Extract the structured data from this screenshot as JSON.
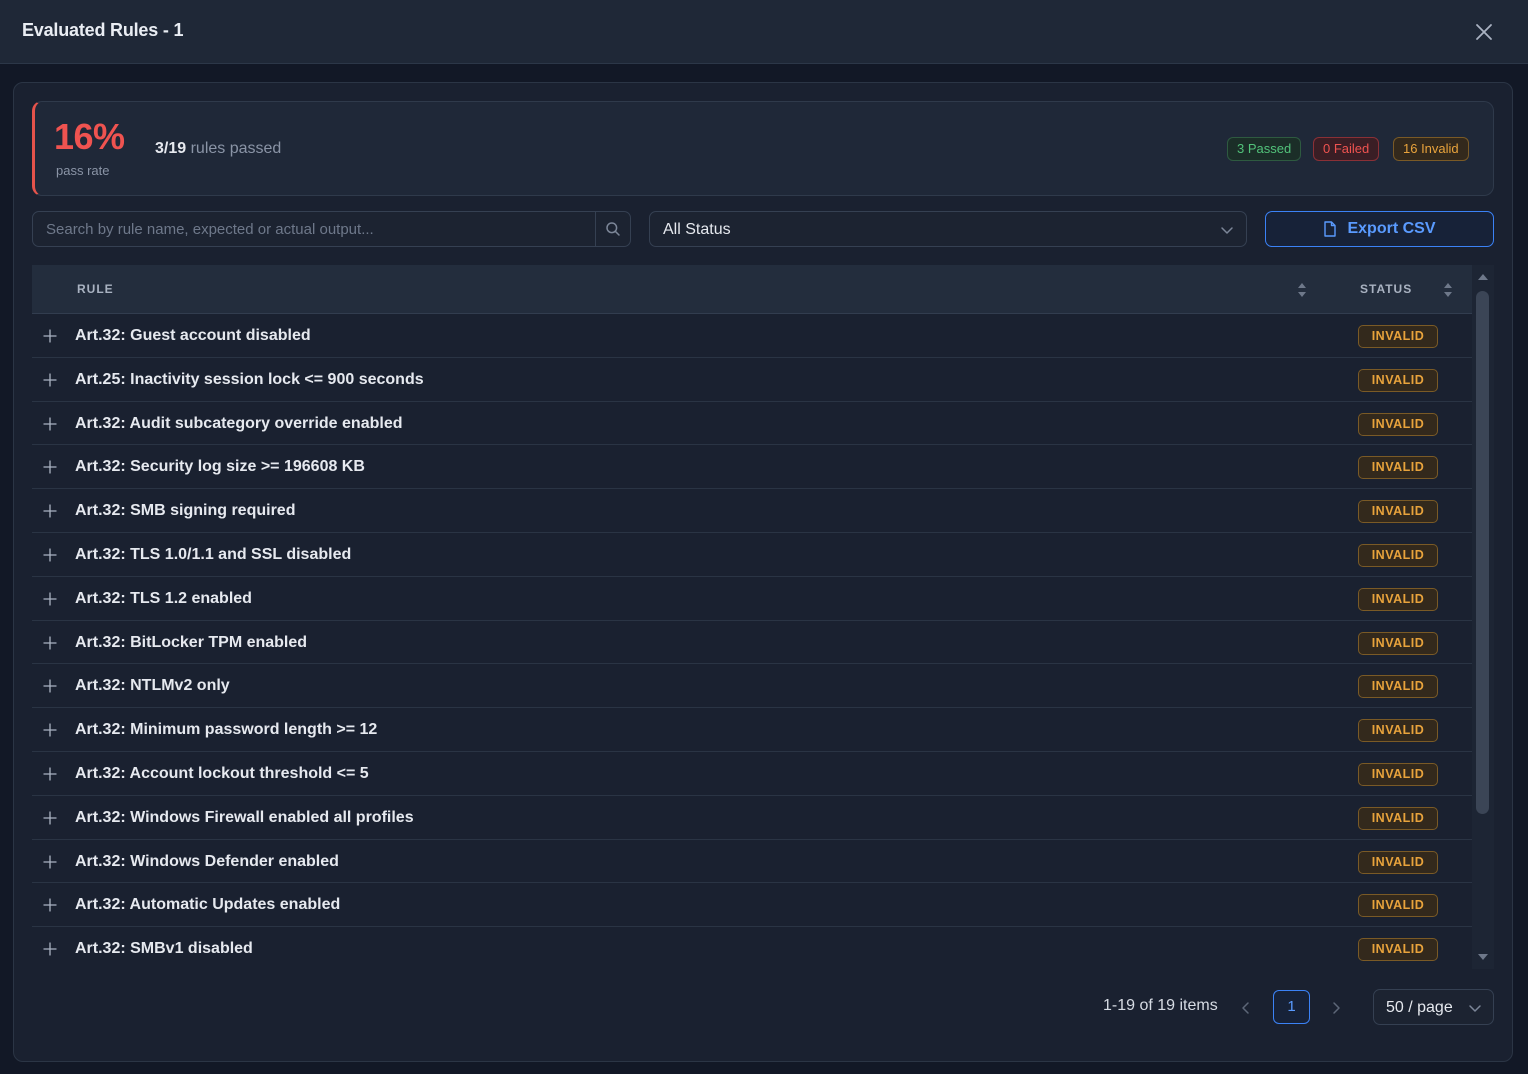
{
  "modal": {
    "title": "Evaluated Rules - 1"
  },
  "summary": {
    "pass_rate": "16%",
    "pass_rate_caption": "pass rate",
    "rules_passed_count": "3/19",
    "rules_passed_text": "rules passed",
    "badges": {
      "passed": "3 Passed",
      "failed": "0 Failed",
      "invalid": "16 Invalid"
    }
  },
  "toolbar": {
    "search_placeholder": "Search by rule name, expected or actual output...",
    "status_filter": "All Status",
    "export_label": "Export CSV"
  },
  "table": {
    "columns": {
      "rule": "RULE",
      "status": "STATUS"
    },
    "rows": [
      {
        "rule": "Art.32: Guest account disabled",
        "status": "INVALID"
      },
      {
        "rule": "Art.25: Inactivity session lock <= 900 seconds",
        "status": "INVALID"
      },
      {
        "rule": "Art.32: Audit subcategory override enabled",
        "status": "INVALID"
      },
      {
        "rule": "Art.32: Security log size >= 196608 KB",
        "status": "INVALID"
      },
      {
        "rule": "Art.32: SMB signing required",
        "status": "INVALID"
      },
      {
        "rule": "Art.32: TLS 1.0/1.1 and SSL disabled",
        "status": "INVALID"
      },
      {
        "rule": "Art.32: TLS 1.2 enabled",
        "status": "INVALID"
      },
      {
        "rule": "Art.32: BitLocker TPM enabled",
        "status": "INVALID"
      },
      {
        "rule": "Art.32: NTLMv2 only",
        "status": "INVALID"
      },
      {
        "rule": "Art.32: Minimum password length >= 12",
        "status": "INVALID"
      },
      {
        "rule": "Art.32: Account lockout threshold <= 5",
        "status": "INVALID"
      },
      {
        "rule": "Art.32: Windows Firewall enabled all profiles",
        "status": "INVALID"
      },
      {
        "rule": "Art.32: Windows Defender enabled",
        "status": "INVALID"
      },
      {
        "rule": "Art.32: Automatic Updates enabled",
        "status": "INVALID"
      },
      {
        "rule": "Art.32: SMBv1 disabled",
        "status": "INVALID"
      }
    ]
  },
  "pagination": {
    "total_text": "1-19 of 19 items",
    "current_page": "1",
    "page_size": "50 / page"
  },
  "colors": {
    "pass_rate": "#ef5350",
    "passed": "#52c27a",
    "failed": "#ef5350",
    "invalid": "#e8a33c",
    "accent": "#3b82f6"
  }
}
